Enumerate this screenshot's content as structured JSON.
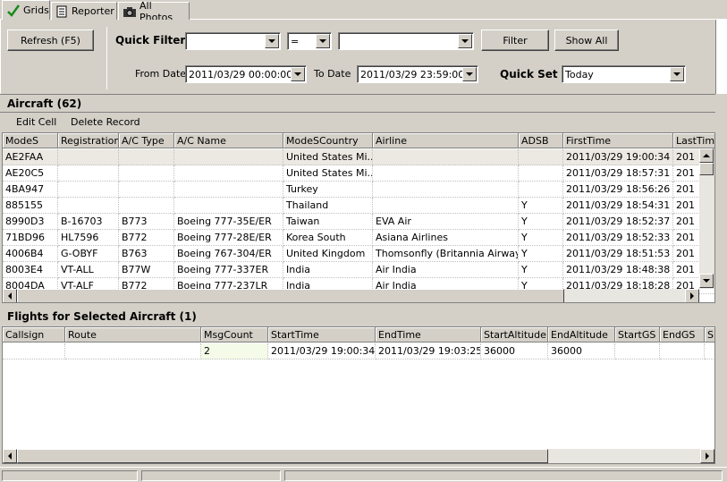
{
  "tabs": [
    {
      "label": "Grids",
      "icon": "checkmark-icon"
    },
    {
      "label": "Reporter",
      "icon": "document-icon"
    },
    {
      "label": "All Photos",
      "icon": "camera-icon"
    }
  ],
  "toolbar": {
    "refresh_label": "Refresh (F5)",
    "quick_filter_label": "Quick Filter",
    "filter_field_value": "",
    "operator_value": "=",
    "filter_value": "",
    "filter_label": "Filter",
    "show_all_label": "Show All",
    "from_date_label": "From Date",
    "from_date_value": "2011/03/29 00:00:00",
    "to_date_label": "To Date",
    "to_date_value": "2011/03/29 23:59:00",
    "quick_set_label": "Quick Set",
    "quick_set_value": "Today"
  },
  "aircraft": {
    "title": "Aircraft (62)",
    "edit_cell_label": "Edit Cell",
    "delete_record_label": "Delete Record",
    "columns": [
      "ModeS",
      "Registration",
      "A/C Type",
      "A/C Name",
      "ModeSCountry",
      "Airline",
      "ADSB",
      "FirstTime",
      "LastTim"
    ],
    "rows": [
      [
        "AE2FAA",
        "",
        "",
        "",
        "United States Mi...",
        "",
        "",
        "2011/03/29 19:00:34",
        "201"
      ],
      [
        "AE20C5",
        "",
        "",
        "",
        "United States Mi...",
        "",
        "",
        "2011/03/29 18:57:31",
        "201"
      ],
      [
        "4BA947",
        "",
        "",
        "",
        "Turkey",
        "",
        "",
        "2011/03/29 18:56:26",
        "201"
      ],
      [
        "885155",
        "",
        "",
        "",
        "Thailand",
        "",
        "Y",
        "2011/03/29 18:54:31",
        "201"
      ],
      [
        "8990D3",
        "B-16703",
        "B773",
        "Boeing 777-35E/ER",
        "Taiwan",
        "EVA Air",
        "Y",
        "2011/03/29 18:52:37",
        "201"
      ],
      [
        "71BD96",
        "HL7596",
        "B772",
        "Boeing 777-28E/ER",
        "Korea South",
        "Asiana Airlines",
        "Y",
        "2011/03/29 18:52:33",
        "201"
      ],
      [
        "4006B4",
        "G-OBYF",
        "B763",
        "Boeing 767-304/ER",
        "United Kingdom",
        "Thomsonfly (Britannia Airways)",
        "Y",
        "2011/03/29 18:51:53",
        "201"
      ],
      [
        "8003E4",
        "VT-ALL",
        "B77W",
        "Boeing 777-337ER",
        "India",
        "Air India",
        "Y",
        "2011/03/29 18:48:38",
        "201"
      ],
      [
        "8004DA",
        "VT-ALF",
        "B772",
        "Boeing 777-237LR",
        "India",
        "Air India",
        "Y",
        "2011/03/29 18:18:28",
        "201"
      ]
    ]
  },
  "flights": {
    "title": "Flights for Selected Aircraft (1)",
    "columns": [
      "Callsign",
      "Route",
      "MsgCount",
      "StartTime",
      "EndTime",
      "StartAltitude",
      "EndAltitude",
      "StartGS",
      "EndGS",
      "S"
    ],
    "rows": [
      [
        "",
        "",
        "2",
        "2011/03/29 19:00:34",
        "2011/03/29 19:03:25",
        "36000",
        "36000",
        "",
        "",
        ""
      ]
    ]
  }
}
